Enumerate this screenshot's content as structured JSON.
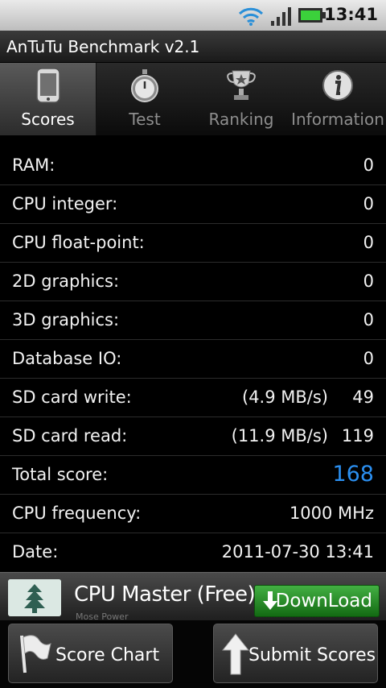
{
  "status_bar": {
    "time": "13:41"
  },
  "app": {
    "title": "AnTuTu Benchmark v2.1"
  },
  "tabs": [
    {
      "label": "Scores",
      "icon": "phone-icon"
    },
    {
      "label": "Test",
      "icon": "stopwatch-icon"
    },
    {
      "label": "Ranking",
      "icon": "trophy-icon"
    },
    {
      "label": "Information",
      "icon": "info-icon"
    }
  ],
  "scores": {
    "ram": {
      "label": "RAM:",
      "value": "0"
    },
    "cpu_integer": {
      "label": "CPU integer:",
      "value": "0"
    },
    "cpu_float": {
      "label": "CPU float-point:",
      "value": "0"
    },
    "graphics_2d": {
      "label": "2D graphics:",
      "value": "0"
    },
    "graphics_3d": {
      "label": "3D graphics:",
      "value": "0"
    },
    "database_io": {
      "label": "Database IO:",
      "value": "0"
    },
    "sd_write": {
      "label": "SD card write:",
      "rate": "(4.9 MB/s)",
      "value": "49"
    },
    "sd_read": {
      "label": "SD card read:",
      "rate": "(11.9 MB/s)",
      "value": "119"
    },
    "total": {
      "label": "Total score:",
      "value": "168"
    },
    "cpu_freq": {
      "label": "CPU frequency:",
      "value": "1000 MHz"
    },
    "date": {
      "label": "Date:",
      "value": "2011-07-30 13:41"
    }
  },
  "ad": {
    "title": "CPU Master (Free)",
    "subtitle": "Mose Power",
    "button": "DownLoad"
  },
  "buttons": {
    "score_chart": "Score Chart",
    "submit_scores": "Submit Scores"
  },
  "colors": {
    "total_score": "#2b8ff0",
    "download_button": "#2e8f2e"
  }
}
